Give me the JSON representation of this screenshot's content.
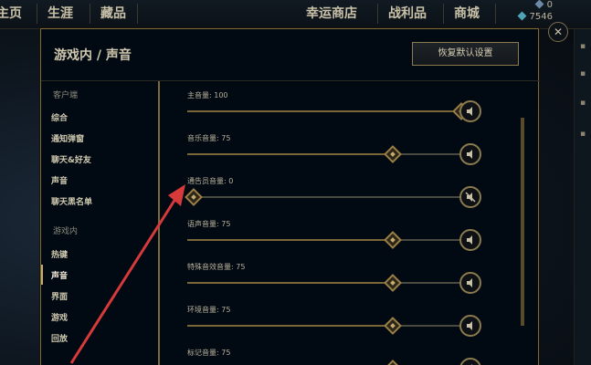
{
  "topnav": {
    "home": "主页",
    "career": "生涯",
    "collection": "藏品",
    "lucky_shop": "幸运商店",
    "loot": "战利品",
    "store": "商城"
  },
  "currency": {
    "top_value": "0",
    "rp_value": "7546"
  },
  "dialog": {
    "title": "游戏内 / 声音",
    "reset_button": "恢复默认设置"
  },
  "sidebar": {
    "client_section": "客户端",
    "client_items": [
      "综合",
      "通知弹窗",
      "聊天&好友",
      "声音",
      "聊天黑名单"
    ],
    "ingame_section": "游戏内",
    "ingame_items": [
      "热键",
      "声音",
      "界面",
      "游戏",
      "回放"
    ]
  },
  "sliders": [
    {
      "label": "主音量: 100",
      "value": 100
    },
    {
      "label": "音乐音量: 75",
      "value": 75
    },
    {
      "label": "通告员音量: 0",
      "value": 0
    },
    {
      "label": "语声音量: 75",
      "value": 75
    },
    {
      "label": "特殊音效音量: 75",
      "value": 75
    },
    {
      "label": "环境音量: 75",
      "value": 75
    },
    {
      "label": "标记音量: 75",
      "value": 75
    }
  ],
  "colors": {
    "gold_border": "#7d6a3c",
    "annotation_arrow": "#d63a3a",
    "text_primary": "#d0c9b0"
  }
}
